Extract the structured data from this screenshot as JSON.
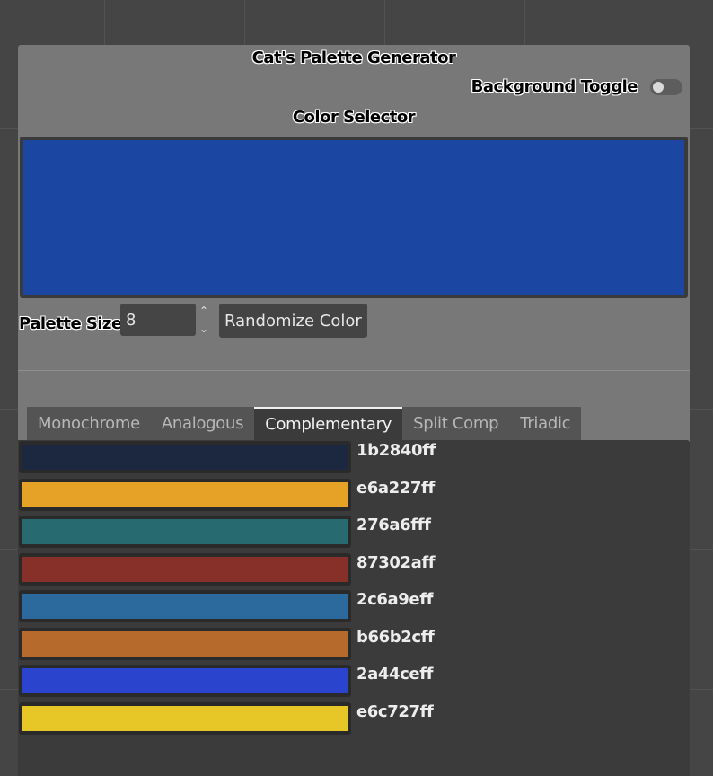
{
  "app": {
    "title": "Cat's Palette Generator"
  },
  "background_toggle": {
    "label": "Background Toggle",
    "on": false
  },
  "color_selector": {
    "label": "Color Selector",
    "color": "#1b46a1"
  },
  "palette_size": {
    "label": "Palette Size",
    "value": "8"
  },
  "randomize": {
    "label": "Randomize Color"
  },
  "tabs": [
    {
      "label": "Monochrome",
      "active": false
    },
    {
      "label": "Analogous",
      "active": false
    },
    {
      "label": "Complementary",
      "active": true
    },
    {
      "label": "Split Comp",
      "active": false
    },
    {
      "label": "Triadic",
      "active": false
    }
  ],
  "palette": [
    {
      "hex": "1b2840ff",
      "color": "#1b2840"
    },
    {
      "hex": "e6a227ff",
      "color": "#e6a227"
    },
    {
      "hex": "276a6fff",
      "color": "#276a6f"
    },
    {
      "hex": "87302aff",
      "color": "#87302a"
    },
    {
      "hex": "2c6a9eff",
      "color": "#2c6a9e"
    },
    {
      "hex": "b66b2cff",
      "color": "#b66b2c"
    },
    {
      "hex": "2a44ceff",
      "color": "#2a44ce"
    },
    {
      "hex": "e6c727ff",
      "color": "#e6c727"
    }
  ]
}
